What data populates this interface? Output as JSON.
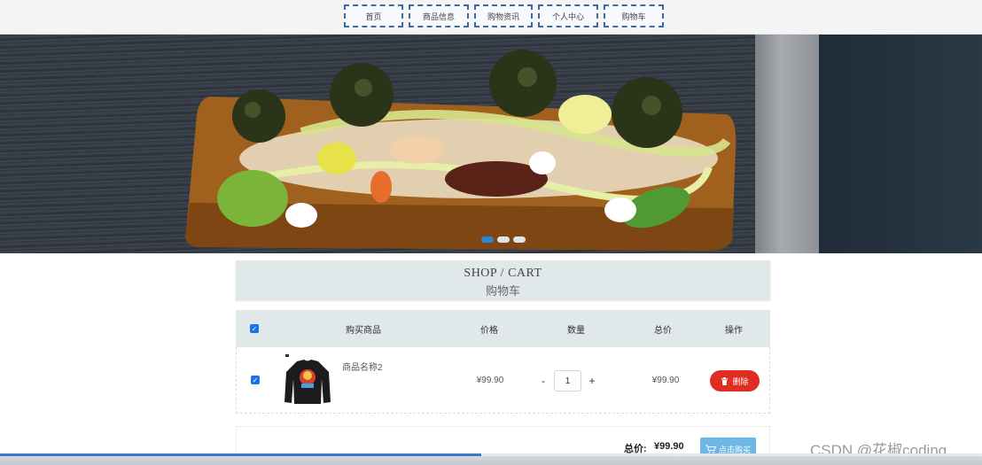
{
  "nav": {
    "items": [
      {
        "label": "首页"
      },
      {
        "label": "商品信息"
      },
      {
        "label": "购物资讯"
      },
      {
        "label": "个人中心"
      },
      {
        "label": "购物车"
      }
    ]
  },
  "banner": {
    "dots": 3,
    "active_dot": 0
  },
  "page_title": {
    "en": "SHOP / CART",
    "cn": "购物车"
  },
  "cart": {
    "columns": [
      "购买商品",
      "价格",
      "数量",
      "总价",
      "操作"
    ],
    "select_all_checked": true,
    "rows": [
      {
        "checked": true,
        "name": "商品名称2",
        "price": "¥99.90",
        "quantity": "1",
        "minus": "-",
        "plus": "+",
        "subtotal": "¥99.90",
        "delete_label": "删除"
      }
    ]
  },
  "footer": {
    "total_label": "总价:",
    "total_value": "¥99.90",
    "buy_label": "点击购买"
  },
  "watermark": "CSDN @花椒coding",
  "load_progress": 0.49
}
